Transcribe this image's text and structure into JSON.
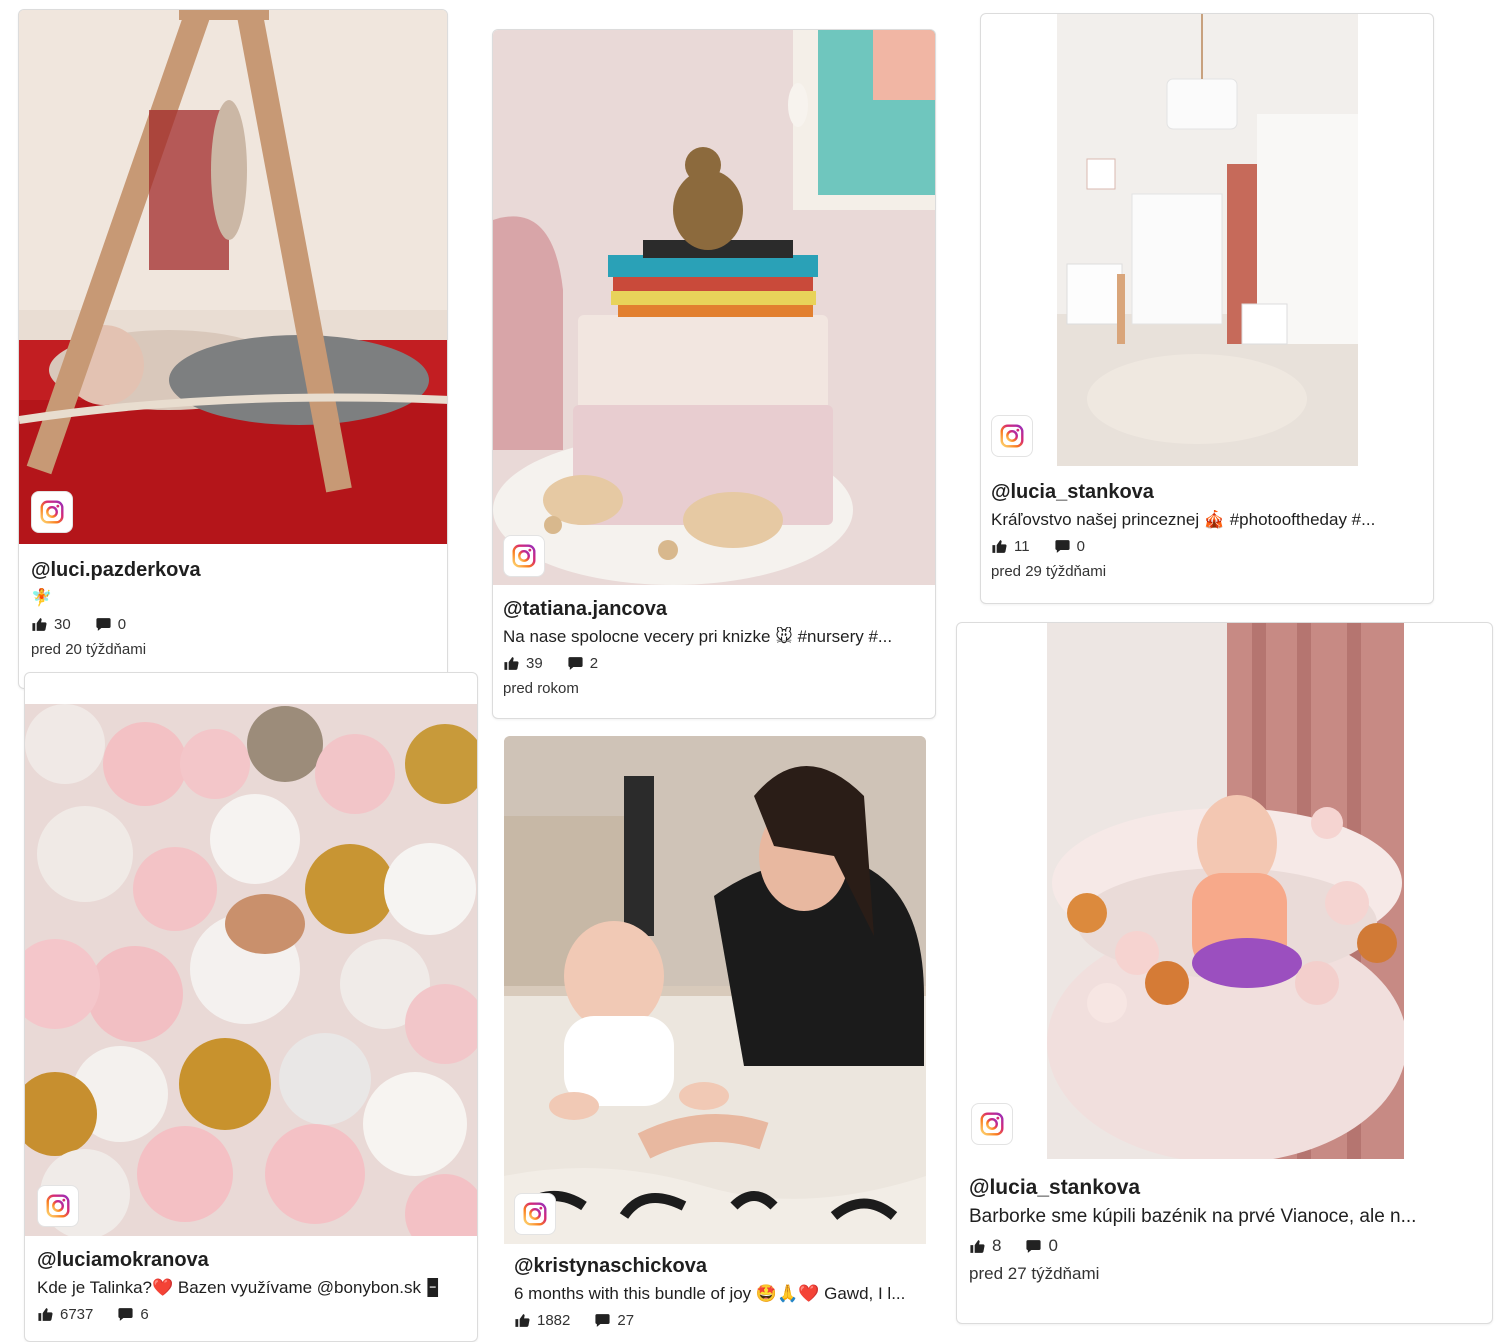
{
  "posts": [
    {
      "handle": "@luci.pazderkova",
      "caption": "🧚",
      "likes": "30",
      "comments": "0",
      "ago": "pred 20 týždňami",
      "image_desc": "Baby lying on red blanket under a wooden play gym"
    },
    {
      "handle": "@tatiana.jancova",
      "caption": "Na nase spolocne vecery pri knizke 🐭 #nursery #...",
      "likes": "39",
      "comments": "2",
      "ago": "pred rokom",
      "image_desc": "Mouse lamp on stacked books and pastel suitcases"
    },
    {
      "handle": "@lucia_stankova",
      "caption": "Kráľovstvo našej princeznej 🎪 #photooftheday #...",
      "likes": "11",
      "comments": "0",
      "ago": "pred 29 týždňami",
      "image_desc": "Bright nursery room with white furniture"
    },
    {
      "handle": "@luciamokranova",
      "caption": "Kde je Talinka?❤️ Bazen využívame @bonybon.sk 🁢",
      "likes": "6737",
      "comments": "6",
      "ago": "",
      "image_desc": "Child hidden in pink, white and gold ball pit"
    },
    {
      "handle": "@kristynaschickova",
      "caption": "6 months with this bundle of joy 🤩🙏❤️ Gawd, I l...",
      "likes": "1882",
      "comments": "27",
      "ago": "",
      "image_desc": "Mother and baby lying on a rug smiling"
    },
    {
      "handle": "@lucia_stankova",
      "caption": "Barborke sme kúpili bazénik na prvé Vianoce, ale n...",
      "likes": "8",
      "comments": "0",
      "ago": "pred 27 týždňami",
      "image_desc": "Baby sitting in a round pink ball pool"
    }
  ],
  "icons": {
    "instagram": "instagram-icon",
    "like": "thumbs-up-icon",
    "comment": "speech-bubble-icon"
  },
  "colors": {
    "card_border": "#dcdcdc",
    "instagram_gradient": [
      "#feda75",
      "#fa7e1e",
      "#d62976",
      "#962fbf"
    ]
  }
}
